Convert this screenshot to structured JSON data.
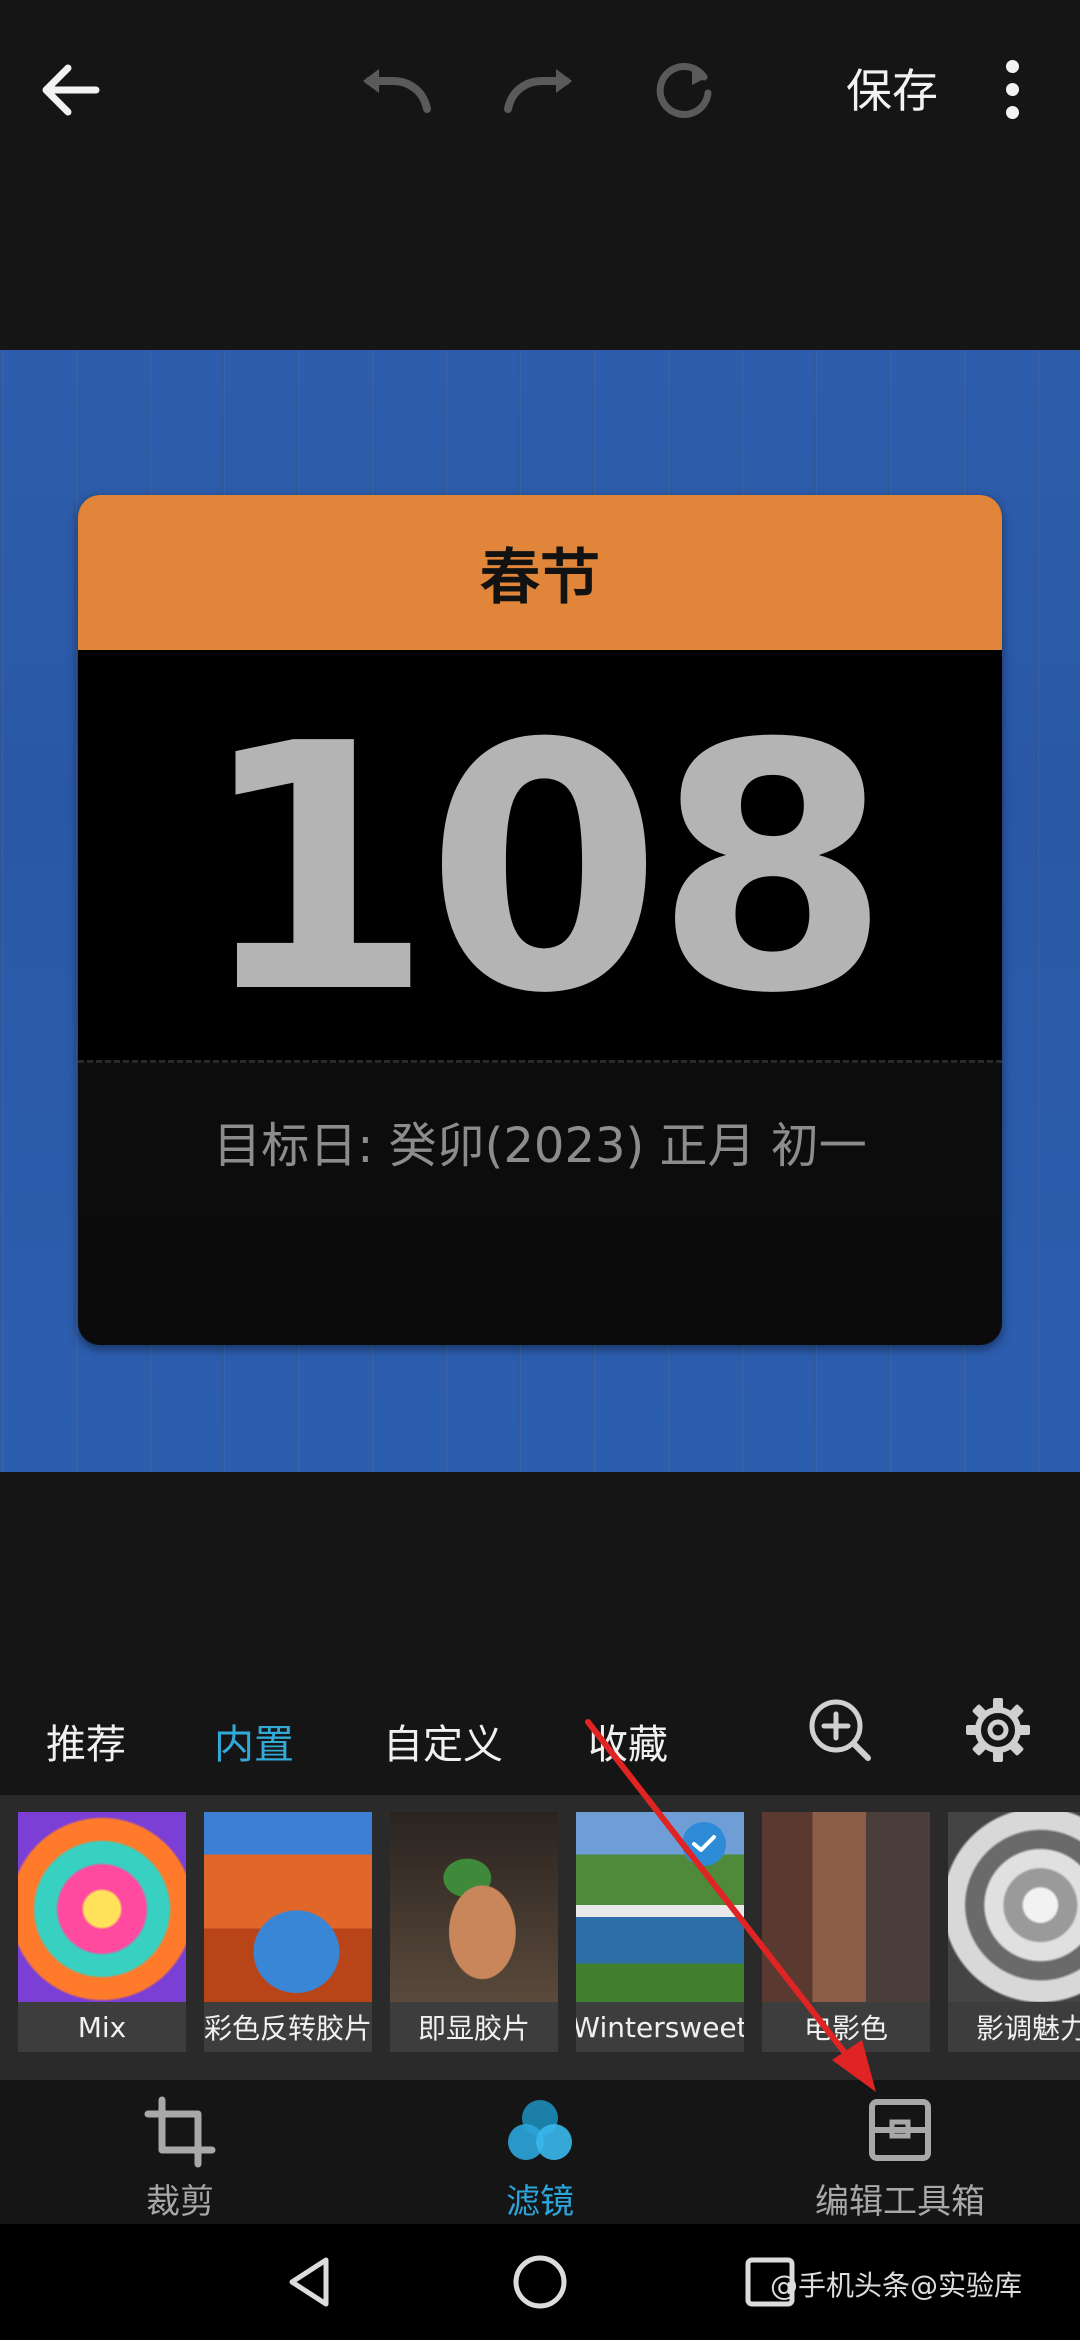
{
  "toolbar": {
    "save_label": "保存",
    "icons": [
      "back-arrow-icon",
      "undo-icon",
      "redo-icon",
      "reset-icon",
      "more-vert-icon"
    ]
  },
  "card": {
    "title": "春节",
    "days": "108",
    "target_text": "目标日: 癸卯(2023) 正月 初一"
  },
  "filter_tabs": [
    {
      "label": "推荐",
      "active": false
    },
    {
      "label": "内置",
      "active": true
    },
    {
      "label": "自定义",
      "active": false
    },
    {
      "label": "收藏",
      "active": false
    }
  ],
  "filters": [
    {
      "label": "Mix"
    },
    {
      "label": "彩色反转胶片"
    },
    {
      "label": "即显胶片"
    },
    {
      "label": "Wintersweet",
      "selected": true
    },
    {
      "label": "电影色"
    },
    {
      "label": "影调魅力"
    }
  ],
  "bottom_nav": [
    {
      "label": "裁剪",
      "icon": "crop-icon"
    },
    {
      "label": "滤镜",
      "icon": "filter-icon",
      "active": true
    },
    {
      "label": "编辑工具箱",
      "icon": "toolbox-icon"
    }
  ],
  "watermark": "@手机头条@实验库",
  "colors": {
    "accent": "#2ba5dc",
    "card_header": "#e0853a",
    "background_wood": "#2c5dac"
  }
}
